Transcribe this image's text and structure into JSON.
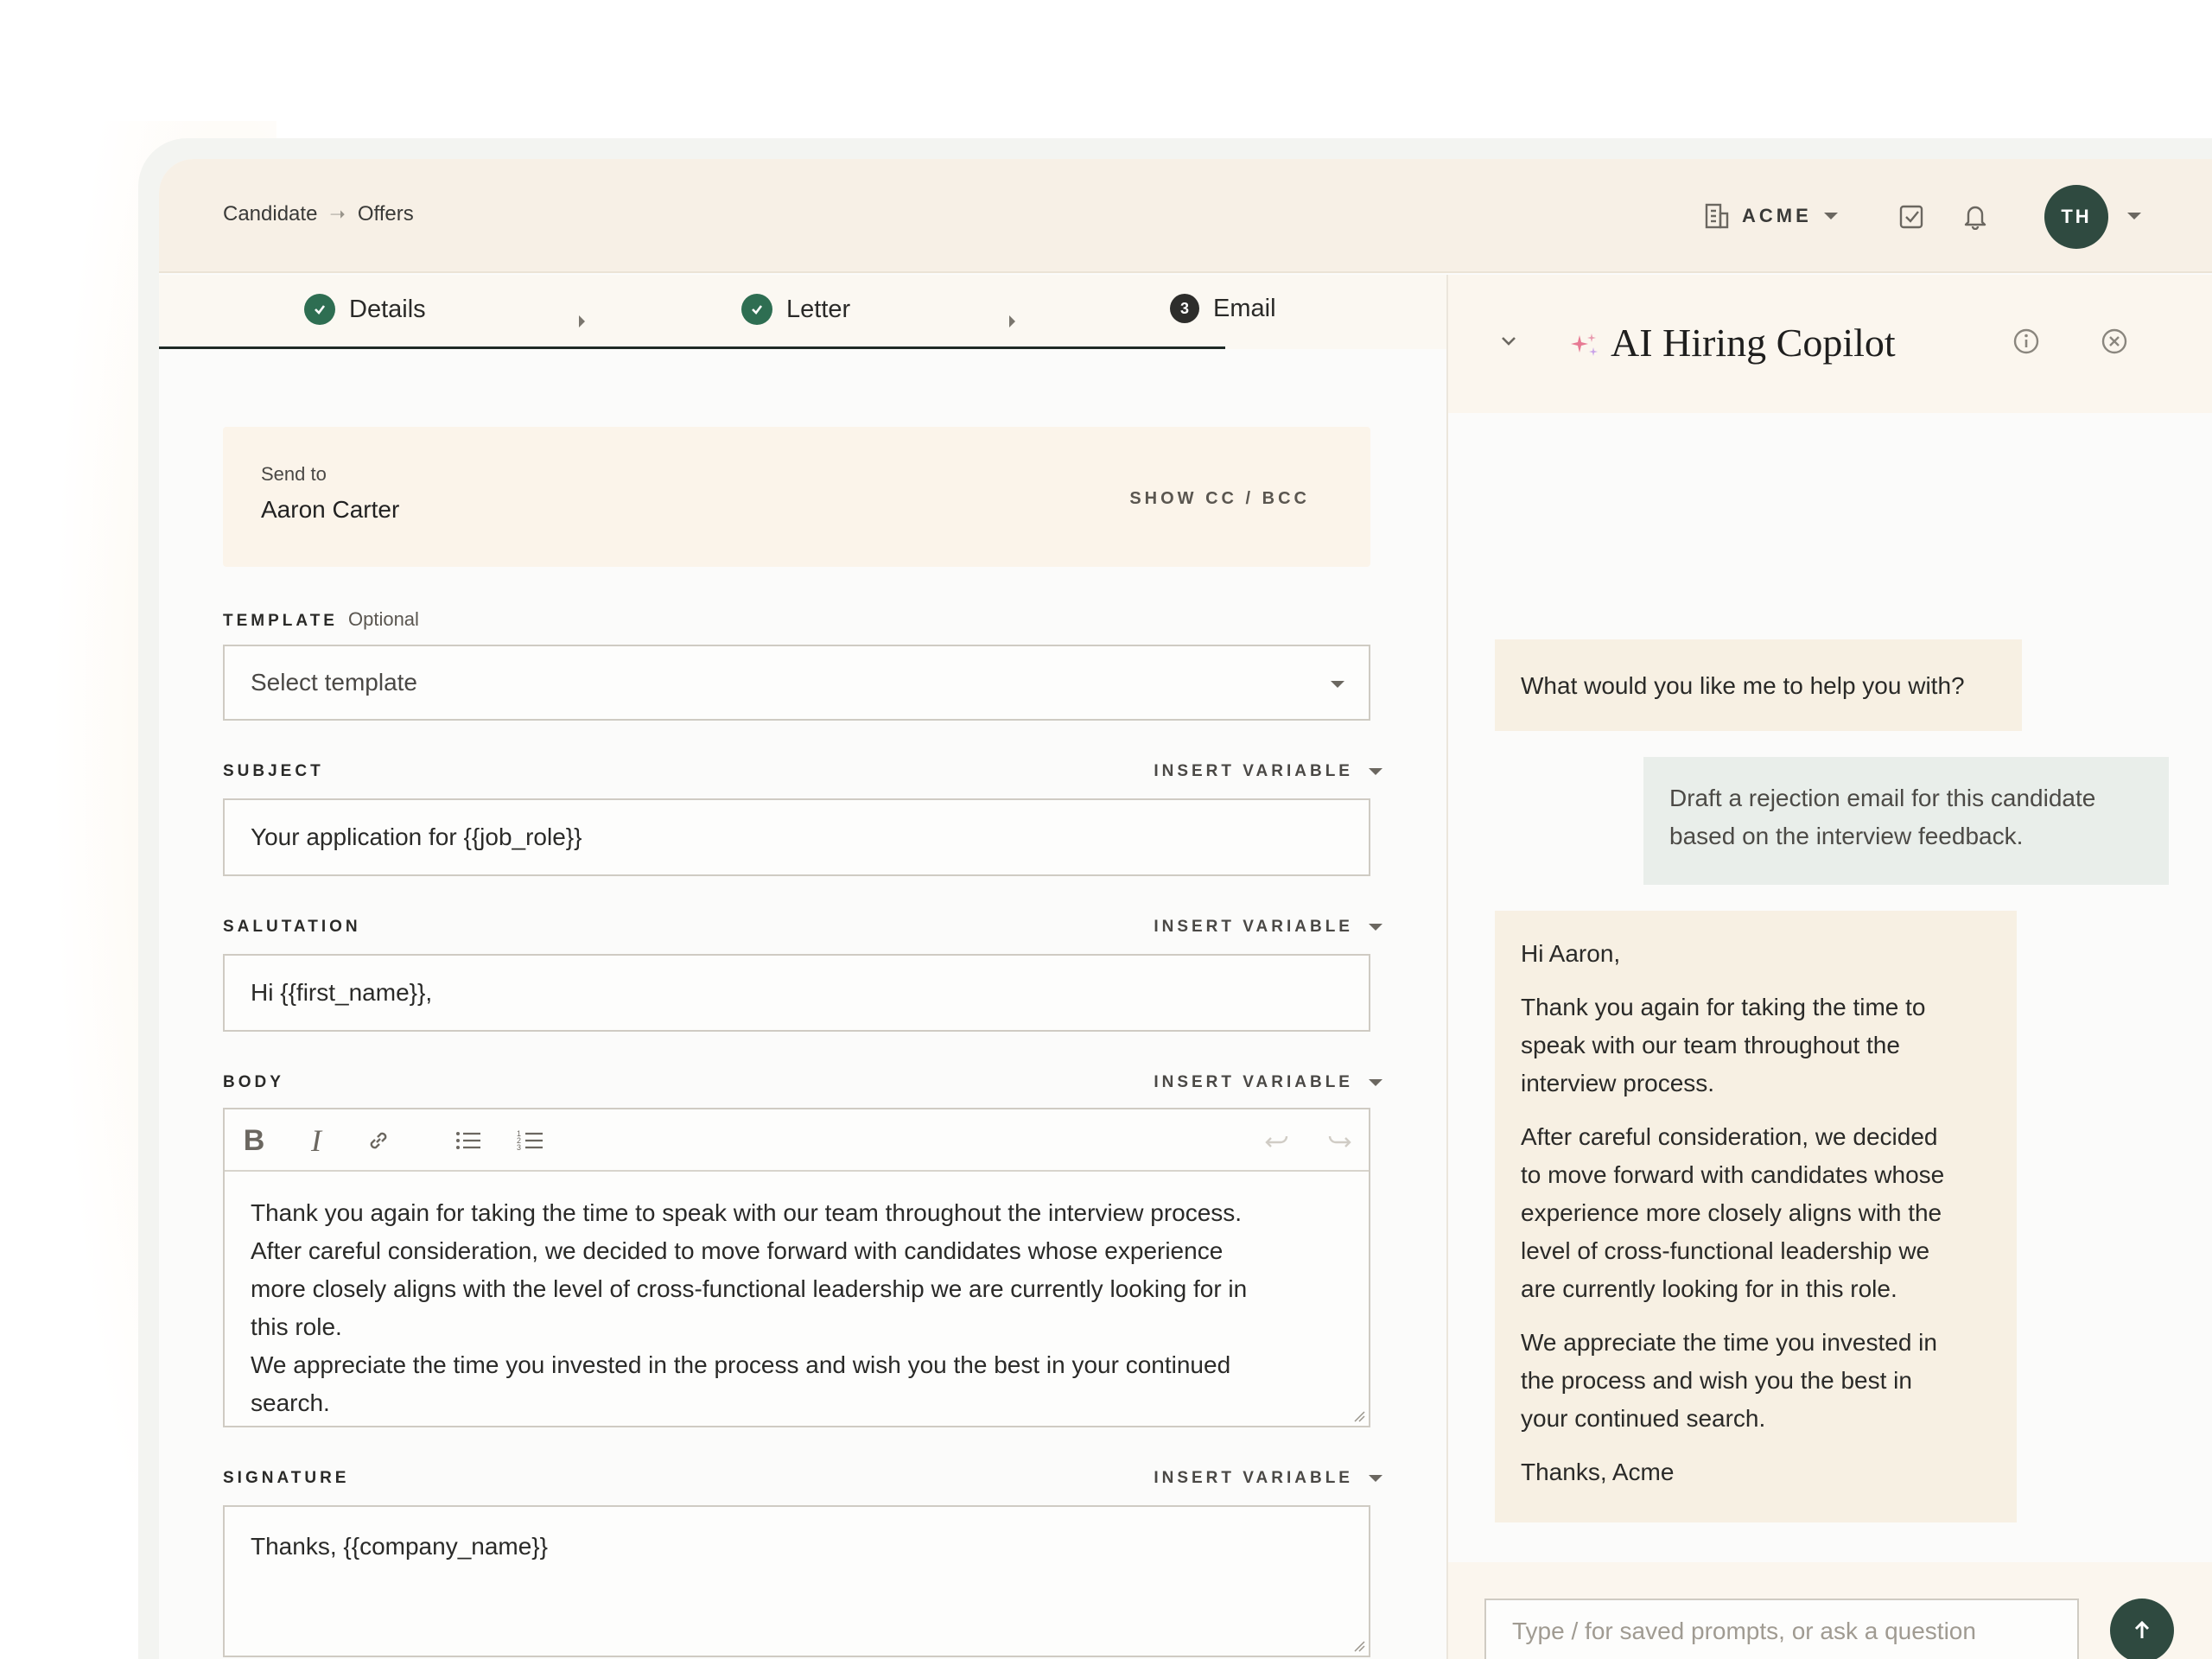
{
  "breadcrumb": {
    "parent": "Candidate",
    "current": "Offers"
  },
  "topbar": {
    "org_name": "ACME",
    "avatar_initials": "TH"
  },
  "stepper": {
    "steps": [
      {
        "label": "Details",
        "state": "done"
      },
      {
        "label": "Letter",
        "state": "done"
      },
      {
        "label": "Email",
        "state": "current",
        "number": "3"
      }
    ]
  },
  "send_to": {
    "label": "Send to",
    "recipient": "Aaron Carter",
    "cc_toggle": "SHOW CC / BCC"
  },
  "template": {
    "label": "TEMPLATE",
    "optional": "Optional",
    "placeholder": "Select template"
  },
  "insert_variable_label": "INSERT VARIABLE",
  "subject": {
    "label": "SUBJECT",
    "value": "Your application for {{job_role}}"
  },
  "salutation": {
    "label": "SALUTATION",
    "value": "Hi {{first_name}},"
  },
  "body": {
    "label": "BODY",
    "lines": [
      "Thank you again for taking the time to speak with our team throughout the interview process.",
      "After careful consideration, we decided to move forward with candidates whose experience",
      "more closely aligns with the level of cross-functional leadership we are currently looking for in",
      "this role.",
      "We appreciate the time you invested in the process and wish you the best in your continued",
      "search."
    ]
  },
  "signature": {
    "label": "SIGNATURE",
    "value": "Thanks, {{company_name}}"
  },
  "copilot": {
    "title": "AI Hiring Copilot",
    "messages": {
      "ai_prompt": "What would you like me to help you with?",
      "user_lines": [
        "Draft a rejection email for this candidate",
        "based on the interview feedback."
      ],
      "ai_reply": {
        "greeting": "Hi Aaron,",
        "p1": [
          "Thank you again for taking the time to",
          "speak with our team throughout the",
          "interview process."
        ],
        "p2": [
          "After careful consideration, we decided",
          "to move forward with candidates whose",
          "experience more closely aligns with the",
          "level of cross-functional leadership we",
          "are currently looking for in this role."
        ],
        "p3": [
          "We appreciate the time you invested in",
          "the process and wish you the best in",
          "your continued search."
        ],
        "signoff": "Thanks, Acme"
      }
    },
    "composer_placeholder": "Type / for saved prompts, or ask a question"
  },
  "colors": {
    "accent_green": "#2e6e52",
    "dark_green": "#2f4a40",
    "cream": "#f7f0e6"
  }
}
